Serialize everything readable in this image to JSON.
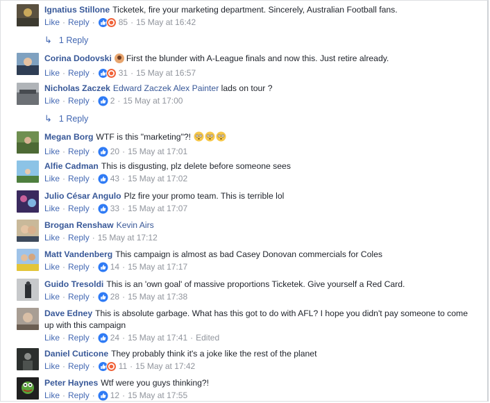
{
  "comments": [
    {
      "author": "Ignatius Stillone",
      "text": "Ticketek, fire your marketing department. Sincerely, Australian Football fans.",
      "reactions": "85",
      "time": "15 May at 16:42",
      "reaction_type": "like-angry",
      "replies": "1 Reply"
    },
    {
      "author": "Corina Dodovski",
      "text": "First the blunder with A-League finals and now this. Just retire already.",
      "reactions": "31",
      "time": "15 May at 16:57",
      "reaction_type": "like-angry"
    },
    {
      "author": "Nicholas Zaczek",
      "mentions": [
        "Edward Zaczek",
        "Alex Painter"
      ],
      "text": "lads on tour ?",
      "reactions": "2",
      "time": "15 May at 17:00",
      "reaction_type": "like",
      "replies": "1 Reply"
    },
    {
      "author": "Megan Borg",
      "text": "WTF is this \"marketing\"?!",
      "reactions": "20",
      "time": "15 May at 17:01",
      "reaction_type": "like",
      "emoji_count": 3
    },
    {
      "author": "Alfie Cadman",
      "text": "This is disgusting, plz delete before someone sees",
      "reactions": "43",
      "time": "15 May at 17:02",
      "reaction_type": "like"
    },
    {
      "author": "Julio César Angulo",
      "text": "Plz fire your promo team. This is terrible lol",
      "reactions": "33",
      "time": "15 May at 17:07",
      "reaction_type": "like"
    },
    {
      "author": "Brogan Renshaw",
      "mentions": [
        "Kevin Airs"
      ],
      "text": "",
      "time": "15 May at 17:12"
    },
    {
      "author": "Matt Vandenberg",
      "text": "This campaign is almost as bad Casey Donovan commercials for Coles",
      "reactions": "14",
      "time": "15 May at 17:17",
      "reaction_type": "like"
    },
    {
      "author": "Guido Tresoldi",
      "text": "This is an 'own goal' of massive proportions Ticketek. Give yourself a Red Card.",
      "reactions": "28",
      "time": "15 May at 17:38",
      "reaction_type": "like"
    },
    {
      "author": "Dave Edney",
      "text": "This is absolute garbage. What has this got to do with AFL? I hope you didn't pay someone to come up with this campaign",
      "reactions": "24",
      "time": "15 May at 17:41",
      "edited": "Edited",
      "reaction_type": "like"
    },
    {
      "author": "Daniel Cuticone",
      "text": "They probably think it's a joke like the rest of the planet",
      "reactions": "11",
      "time": "15 May at 17:42",
      "reaction_type": "like-angry"
    },
    {
      "author": "Peter Haynes",
      "text": "Wtf were you guys thinking?!",
      "reactions": "12",
      "time": "15 May at 17:55",
      "reaction_type": "like"
    }
  ],
  "actions": {
    "like": "Like",
    "reply": "Reply",
    "dot": "·"
  },
  "colors": {
    "link": "#385898",
    "action": "#4267b2",
    "meta": "#90949c",
    "like_blue": "#2f7bf5",
    "angry_orange": "#f0633a"
  },
  "icons": {
    "like": "thumbs-up-icon",
    "angry": "angry-face-icon",
    "reply_arrow": "reply-arrow-icon",
    "emoji": "flushed-face-icon"
  }
}
